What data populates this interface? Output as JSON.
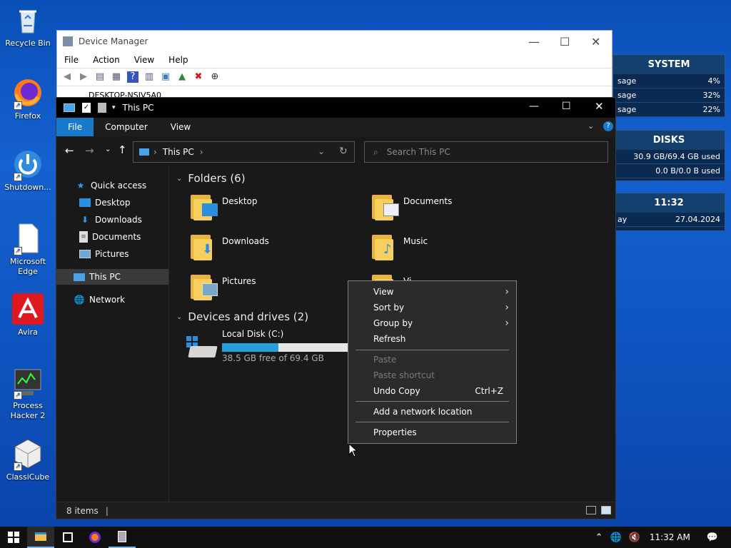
{
  "desktop": {
    "icons": [
      {
        "label": "Recycle Bin",
        "icon": "recycle-bin-icon"
      },
      {
        "label": "Firefox",
        "icon": "firefox-icon"
      },
      {
        "label": "Shutdown...",
        "icon": "power-icon"
      },
      {
        "label": "Microsoft Edge",
        "icon": "edge-icon"
      },
      {
        "label": "Avira",
        "icon": "avira-icon"
      },
      {
        "label": "Process Hacker 2",
        "icon": "process-hacker-icon"
      },
      {
        "label": "ClassiCube",
        "icon": "classicube-icon"
      }
    ]
  },
  "widgets": {
    "system": {
      "title": "SYSTEM",
      "rows": [
        {
          "label": "sage",
          "value": "4%"
        },
        {
          "label": "sage",
          "value": "32%"
        },
        {
          "label": "sage",
          "value": "22%"
        }
      ]
    },
    "disks": {
      "title": "DISKS",
      "rows": [
        {
          "value": "30.9 GB/69.4 GB used"
        },
        {
          "value": "0.0 B/0.0 B used"
        }
      ]
    },
    "clock": {
      "title": "11:32",
      "label": "ay",
      "date": "27.04.2024"
    }
  },
  "device_manager": {
    "title": "Device Manager",
    "menu": [
      "File",
      "Action",
      "View",
      "Help"
    ],
    "tree_root": "DESKTOP-NSIV5A0"
  },
  "explorer": {
    "title": "This PC",
    "ribbon_tabs": [
      "File",
      "Computer",
      "View"
    ],
    "address": "This PC",
    "search_placeholder": "Search This PC",
    "nav": {
      "quick_access": "Quick access",
      "items": [
        "Desktop",
        "Downloads",
        "Documents",
        "Pictures"
      ],
      "this_pc": "This PC",
      "network": "Network"
    },
    "folders_header": "Folders (6)",
    "folders": [
      "Desktop",
      "Documents",
      "Downloads",
      "Music",
      "Pictures",
      "Vi"
    ],
    "drives_header": "Devices and drives (2)",
    "drive": {
      "name": "Local Disk (C:)",
      "free": "38.5 GB free of 69.4 GB",
      "used_fraction": 0.445
    },
    "status": "8 items"
  },
  "context_menu": {
    "items": [
      {
        "label": "View",
        "submenu": true
      },
      {
        "label": "Sort by",
        "submenu": true
      },
      {
        "label": "Group by",
        "submenu": true
      },
      {
        "label": "Refresh"
      },
      {
        "label": "Paste",
        "disabled": true
      },
      {
        "label": "Paste shortcut",
        "disabled": true
      },
      {
        "label": "Undo Copy",
        "shortcut": "Ctrl+Z"
      },
      {
        "label": "Add a network location"
      },
      {
        "label": "Properties"
      }
    ]
  },
  "taskbar": {
    "time": "11:32 AM"
  },
  "colors": {
    "accent": "#0078d7",
    "desktop": "#1561cf",
    "drive_bar": "#26a0da"
  }
}
